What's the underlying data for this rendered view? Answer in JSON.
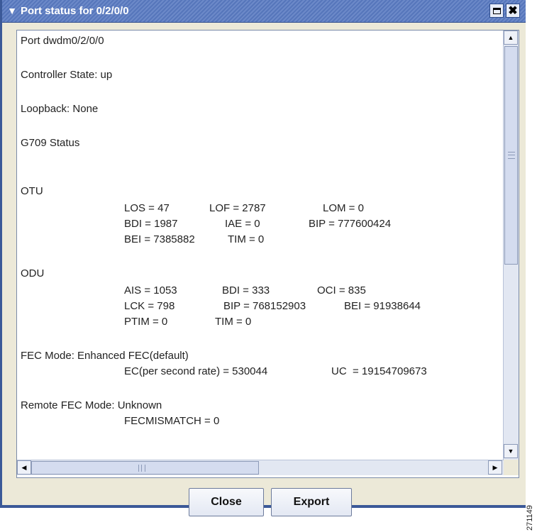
{
  "window": {
    "title": "Port status for 0/2/0/0",
    "menu_icon": "chevron-down-icon",
    "maximize_icon": "maximize-icon",
    "close_icon": "close-icon"
  },
  "status": {
    "port": "Port dwdm0/2/0/0",
    "controller_state": "Controller State: up",
    "loopback": "Loopback: None",
    "g709_status": "G709 Status",
    "otu_header": "OTU",
    "otu": [
      {
        "a": "LOS = 47",
        "b": "LOF = 2787",
        "c": "LOM = 0"
      },
      {
        "a": "BDI = 1987",
        "b": "IAE = 0",
        "c": "BIP = 777600424"
      },
      {
        "a": "BEI = 7385882",
        "b": "TIM = 0",
        "c": ""
      }
    ],
    "odu_header": "ODU",
    "odu": [
      {
        "a": "AIS = 1053",
        "b": "BDI = 333",
        "c": "OCI = 835"
      },
      {
        "a": "LCK = 798",
        "b": "BIP = 768152903",
        "c": "BEI = 91938644"
      },
      {
        "a": "PTIM = 0",
        "b": "TIM = 0",
        "c": ""
      }
    ],
    "fec_mode": "FEC Mode: Enhanced FEC(default)",
    "fec_ec": "EC(per second rate) = 530044",
    "fec_uc": "UC  = 19154709673",
    "remote_fec_mode": "Remote FEC Mode: Unknown",
    "fec_mismatch": "FECMISMATCH = 0"
  },
  "buttons": {
    "close": "Close",
    "export": "Export"
  },
  "side_tag": "271149"
}
